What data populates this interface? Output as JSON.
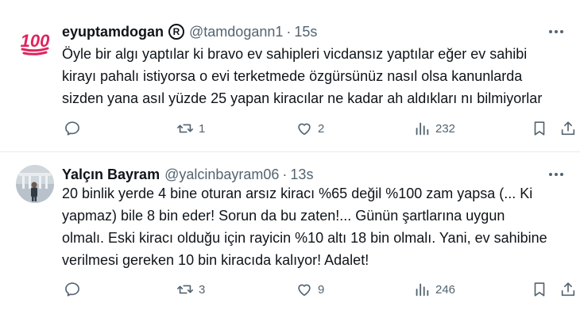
{
  "tweets": [
    {
      "author": {
        "name": "eyuptamdogan",
        "badge": "R",
        "handle": "@tamdogann1",
        "avatar": "hundred-points-emoji"
      },
      "separator": "·",
      "time": "15s",
      "text": "Öyle bir algı yaptılar ki bravo ev sahipleri vicdansız yaptılar eğer ev sahibi\nkirayı pahalı istiyorsa o evi terketmede özgürsünüz nasıl olsa kanunlarda\nsizden yana asıl yüzde 25 yapan kiracılar ne kadar ah aldıkları nı bilmiyorlar",
      "stats": {
        "replies": "",
        "retweets": "1",
        "likes": "2",
        "views": "232"
      }
    },
    {
      "author": {
        "name": "Yalçın Bayram",
        "handle": "@yalcinbayram06",
        "avatar": "person-photo"
      },
      "separator": "·",
      "time": "13s",
      "text": "20 binlik yerde 4 bine oturan arsız kiracı %65 değil %100 zam yapsa (... Ki\nyapmaz) bile 8 bin eder! Sorun da bu zaten!... Günün şartlarına uygun\nolmalı. Eski kiracı olduğu için rayicin %10 altı  18 bin olmalı. Yani, ev sahibine\nverilmesi gereken 10 bin kiracıda kalıyor! Adalet!",
      "stats": {
        "replies": "",
        "retweets": "3",
        "likes": "9",
        "views": "246"
      }
    }
  ],
  "icons": {
    "reply": "reply-icon",
    "retweet": "retweet-icon",
    "like": "heart-icon",
    "views": "views-icon",
    "bookmark": "bookmark-icon",
    "share": "share-icon",
    "more": "more-icon"
  },
  "colors": {
    "text": "#0f1419",
    "secondary": "#536471",
    "divider": "#e6ecf0",
    "emoji_red": "#e0245e"
  }
}
